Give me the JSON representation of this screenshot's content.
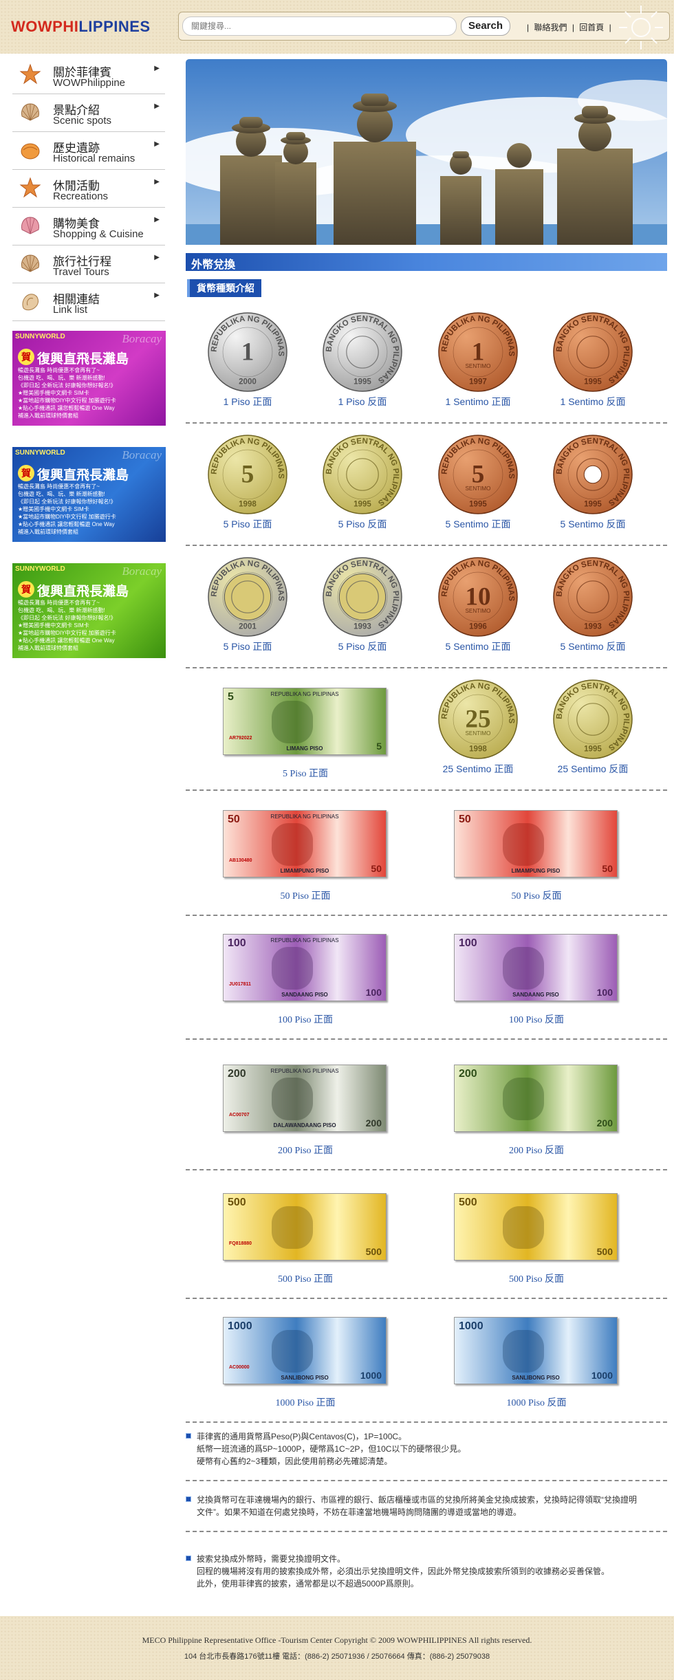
{
  "header": {
    "logo_wow": "WOW",
    "logo_ph1": "PHI",
    "logo_ph2": "L",
    "logo_ph3": "IPPINES",
    "search_placeholder": "關鍵搜尋...",
    "search_button": "Search",
    "link_contact": "聯絡我們",
    "link_home": "回首頁"
  },
  "nav": [
    {
      "zh": "關於菲律賓",
      "en": "WOWPhilippine",
      "icon": "starfish-icon"
    },
    {
      "zh": "景點介紹",
      "en": "Scenic spots",
      "icon": "scallop-shell-icon"
    },
    {
      "zh": "歷史遺跡",
      "en": "Historical remains",
      "icon": "orange-shell-icon"
    },
    {
      "zh": "休閒活動",
      "en": "Recreations",
      "icon": "starfish-icon"
    },
    {
      "zh": "購物美食",
      "en": "Shopping & Cuisine",
      "icon": "pink-shell-icon"
    },
    {
      "zh": "旅行社行程",
      "en": "Travel Tours",
      "icon": "scallop-shell-icon"
    },
    {
      "zh": "相關連結",
      "en": "Link list",
      "icon": "conch-shell-icon"
    }
  ],
  "ads": [
    {
      "brand": "SUNNYWORLD",
      "boracay": "Boracay",
      "badge": "賀",
      "title": "復興直飛長灘島",
      "lines": [
        "暢遊長灘島  時尚優惠不會再有了~",
        "包機遊 吃、喝、玩、樂 新潮新感動!",
        "《即日起 全新玩法 好康報你想好報名!》",
        "★贈美國手機中文網卡 SIM卡",
        "★當地超市購物DIY中文行程 加勝遊行卡",
        "★貼心手機通訊 讓您輕鬆暢遊 One Way",
        "  補進入戰前環球特價套組"
      ]
    },
    {
      "brand": "SUNNYWORLD",
      "boracay": "Boracay",
      "badge": "賀",
      "title": "復興直飛長灘島",
      "lines": [
        "暢遊長灘島  時尚優惠不會再有了~",
        "包機遊 吃、喝、玩、樂 新潮新感動!",
        "《即日起 全新玩法 好康報你想好報名!》",
        "★贈美國手機中文網卡 SIM卡",
        "★當地超市購物DIY中文行程 加勝遊行卡",
        "★貼心手機通訊 讓您輕鬆暢遊 One Way",
        "  補進入戰前環球特價套組"
      ]
    },
    {
      "brand": "SUNNYWORLD",
      "boracay": "Boracay",
      "badge": "賀",
      "title": "復興直飛長灘島",
      "lines": [
        "暢遊長灘島  時尚優惠不會再有了~",
        "包機遊 吃、喝、玩、樂 新潮新感動!",
        "《即日起 全新玩法 好康報你想好報名!》",
        "★贈美國手機中文網卡 SIM卡",
        "★當地超市購物DIY中文行程 加勝遊行卡",
        "★貼心手機通訊 讓您輕鬆暢遊 One Way",
        "  補進入戰前環球特價套組"
      ]
    }
  ],
  "main": {
    "section_title": "外幣兌換",
    "sub_title": "貨幣種類介紹",
    "coins_row1": [
      {
        "cap": "1 Piso 正面",
        "num": "1",
        "yr": "2000",
        "rim": "REPUBLIKA NG PILIPINAS",
        "metal": "silver"
      },
      {
        "cap": "1 Piso 反面",
        "num": "",
        "yr": "1995",
        "rim": "BANGKO SENTRAL NG PILIPINAS",
        "metal": "silver"
      },
      {
        "cap": "1 Sentimo 正面",
        "num": "1",
        "yr": "1997",
        "rim": "REPUBLIKA NG PILIPINAS",
        "metal": "copper",
        "unit": "SENTIMO"
      },
      {
        "cap": "1 Sentimo 反面",
        "num": "",
        "yr": "1995",
        "rim": "BANGKO SENTRAL NG PILIPINAS",
        "metal": "copper"
      }
    ],
    "coins_row2": [
      {
        "cap": "5 Piso 正面",
        "num": "5",
        "yr": "1998",
        "rim": "REPUBLIKA NG PILIPINAS",
        "metal": "brass"
      },
      {
        "cap": "5 Piso 反面",
        "num": "",
        "yr": "1995",
        "rim": "BANGKO SENTRAL NG PILIPINAS",
        "metal": "brass"
      },
      {
        "cap": "5 Sentimo 正面",
        "num": "5",
        "yr": "1995",
        "rim": "REPUBLIKA NG PILIPINAS",
        "metal": "copper",
        "unit": "SENTIMO"
      },
      {
        "cap": "5 Sentimo 反面",
        "num": "",
        "yr": "1995",
        "rim": "BANGKO SENTRAL NG PILIPINAS",
        "metal": "copper",
        "hole": true
      }
    ],
    "coins_row3": [
      {
        "cap": "5 Piso 正面",
        "num": "",
        "yr": "2001",
        "rim": "REPUBLIKA NG PILIPINAS",
        "metal": "bimetal"
      },
      {
        "cap": "5 Piso 反面",
        "num": "",
        "yr": "1993",
        "rim": "BANGKO SENTRAL NG PILIPINAS",
        "metal": "bimetal"
      },
      {
        "cap": "5 Sentimo 正面",
        "num": "10",
        "yr": "1996",
        "rim": "REPUBLIKA NG PILIPINAS",
        "metal": "copper",
        "unit": "SENTIMO"
      },
      {
        "cap": "5 Sentimo 反面",
        "num": "",
        "yr": "1993",
        "rim": "BANGKO SENTRAL NG PILIPINAS",
        "metal": "copper"
      }
    ],
    "row4": {
      "note": {
        "cap": "5 Piso 正面",
        "denom": "5",
        "band": "REPUBLIKA NG PILIPINAS",
        "name": "LIMANG PISO",
        "serial": "AR792022",
        "color": "green"
      },
      "coins": [
        {
          "cap": "25 Sentimo 正面",
          "num": "25",
          "yr": "1998",
          "rim": "REPUBLIKA NG PILIPINAS",
          "metal": "brass",
          "unit": "SENTIMO"
        },
        {
          "cap": "25 Sentimo 反面",
          "num": "",
          "yr": "1995",
          "rim": "BANGKO SENTRAL NG PILIPINAS",
          "metal": "brass"
        }
      ]
    },
    "notes": [
      {
        "front": {
          "cap": "50 Piso 正面",
          "denom": "50",
          "band": "REPUBLIKA NG PILIPINAS",
          "name": "LIMAMPUNG PISO",
          "serial": "AB130480",
          "color": "red"
        },
        "back": {
          "cap": "50 Piso 反面",
          "denom": "50",
          "band": "",
          "name": "LIMAMPUNG PISO",
          "serial": "",
          "color": "red"
        }
      },
      {
        "front": {
          "cap": "100 Piso 正面",
          "denom": "100",
          "band": "REPUBLIKA NG PILIPINAS",
          "name": "SANDAANG PISO",
          "serial": "JU017811",
          "color": "violet"
        },
        "back": {
          "cap": "100 Piso 反面",
          "denom": "100",
          "band": "",
          "name": "SANDAANG PISO",
          "serial": "",
          "color": "violet"
        }
      },
      {
        "front": {
          "cap": "200 Piso 正面",
          "denom": "200",
          "band": "REPUBLIKA NG PILIPINAS",
          "name": "DALAWANDAANG PISO",
          "serial": "AC00707",
          "color": "gray"
        },
        "back": {
          "cap": "200 Piso 反面",
          "denom": "200",
          "band": "",
          "name": "",
          "serial": "",
          "color": "green"
        }
      },
      {
        "front": {
          "cap": "500 Piso 正面",
          "denom": "500",
          "band": "",
          "name": "",
          "serial": "FQ818880",
          "color": "yellow"
        },
        "back": {
          "cap": "500 Piso 反面",
          "denom": "500",
          "band": "",
          "name": "",
          "serial": "",
          "color": "yellow"
        }
      },
      {
        "front": {
          "cap": "1000 Piso 正面",
          "denom": "1000",
          "band": "",
          "name": "SANLIBONG PISO",
          "serial": "AC00000",
          "color": "blue"
        },
        "back": {
          "cap": "1000 Piso 反面",
          "denom": "1000",
          "band": "",
          "name": "SANLIBONG PISO",
          "serial": "",
          "color": "blue"
        }
      }
    ],
    "info": [
      [
        "菲律賓的通用貨幣爲Peso(P)與Centavos(C)，1P=100C。",
        "紙幣一班流通的爲5P~1000P，硬幣爲1C~2P，但10C以下的硬幣很少見。",
        "硬幣有心舊約2~3種類，因此使用前務必先確認清楚。"
      ],
      [
        "兌換貨幣可在菲達機場內的銀行、市區裡的銀行、飯店櫃檯或市區的兌換所將美金兌換成披索，兌換時記得領取“兌換證明",
        "文件”。如果不知道在何處兌換時，不妨在菲達當地機場時詢問隨團的導遊或當地的導遊。"
      ],
      [
        "披索兌換成外幣時，需要兌換證明文件。",
        "回程的機場將沒有用的披索換成外幣，必須出示兌換證明文件，因此外幣兌換成披索所領到的收據務必妥善保管。",
        "此外，使用菲律賓的披索，通常都是以不超過5000P爲原則。"
      ]
    ]
  },
  "footer": {
    "line1": "MECO Philippine Representative Office -Tourism Center    Copyright © 2009 WOWPHILIPPINES All rights reserved.",
    "line2": "104 台北市長春路176號11樓      電話：(886-2) 25071936 / 25076664      傳真：(886-2) 25079038"
  }
}
